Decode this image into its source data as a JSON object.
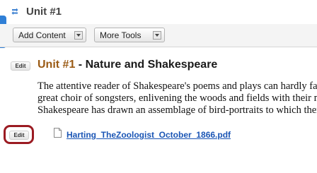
{
  "header": {
    "title": "Unit #1"
  },
  "toolbar": {
    "add_content_label": "Add Content",
    "more_tools_label": "More Tools"
  },
  "content": {
    "edit_label_top": "Edit",
    "unit_number": "Unit #1",
    "unit_title_rest": " - Nature and Shakespeare",
    "body_lines": [
      "The attentive reader of Shakespeare's poems and plays can hardly fail to notice how",
      "great choir of songsters, enlivening the woods and fields with their music. In the",
      "Shakespeare has drawn an assemblage of bird-portraits to which there is no parallel"
    ],
    "edit_label_file": "Edit",
    "file_name": "Harting_TheZoologist_October_1866.pdf"
  },
  "colors": {
    "side_tab": "#2f7fd6",
    "unit_number": "#9a5a14",
    "link": "#1a55b5",
    "highlight_ring": "#9b1b22"
  },
  "icons": {
    "header": "refresh-arrows-icon",
    "file": "document-icon",
    "side_tab": "collapse-arrow-icon"
  }
}
